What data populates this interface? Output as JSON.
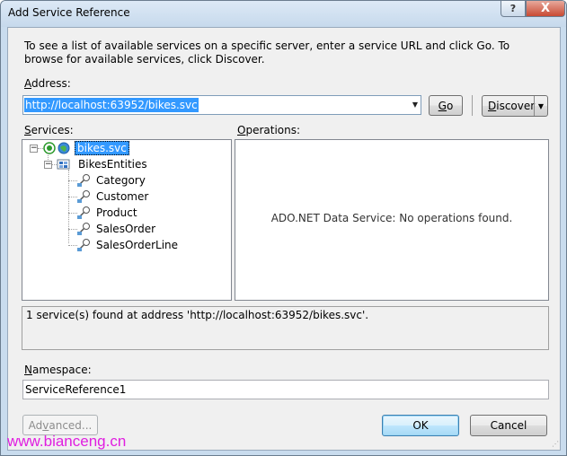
{
  "window": {
    "title": "Add Service Reference",
    "help_glyph": "?",
    "close_glyph": "X"
  },
  "intro_text": "To see a list of available services on a specific server, enter a service URL and click Go. To browse for available services, click Discover.",
  "address": {
    "label_first": "A",
    "label_rest": "ddress:",
    "value": "http://localhost:63952/bikes.svc"
  },
  "buttons": {
    "go_first": "G",
    "go_rest": "o",
    "discover_first": "D",
    "discover_rest": "iscover",
    "advanced_first": "Ad",
    "advanced_ul": "v",
    "advanced_rest": "anced...",
    "ok": "OK",
    "cancel": "Cancel"
  },
  "services": {
    "label_first": "S",
    "label_rest": "ervices:",
    "tree": {
      "service": "bikes.svc",
      "container": "BikesEntities",
      "entities": [
        "Category",
        "Customer",
        "Product",
        "SalesOrder",
        "SalesOrderLine"
      ]
    }
  },
  "operations": {
    "label_first": "O",
    "label_rest": "perations:",
    "message": "ADO.NET Data Service: No operations found."
  },
  "status_text": "1 service(s) found at address 'http://localhost:63952/bikes.svc'.",
  "namespace": {
    "label_first": "N",
    "label_rest": "amespace:",
    "value": "ServiceReference1"
  },
  "watermark": "www.bianceng.cn",
  "colors": {
    "selection": "#3399ff",
    "watermark": "#e01ee0"
  }
}
